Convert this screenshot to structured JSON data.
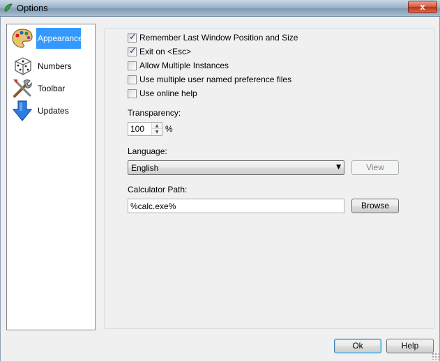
{
  "window": {
    "title": "Options",
    "close_label": "x"
  },
  "sidebar": {
    "items": [
      {
        "label": "Appearance",
        "icon": "palette-icon",
        "selected": true
      },
      {
        "label": "Numbers",
        "icon": "dice-icon",
        "selected": false
      },
      {
        "label": "Toolbar",
        "icon": "tools-icon",
        "selected": false
      },
      {
        "label": "Updates",
        "icon": "download-arrow-icon",
        "selected": false
      }
    ]
  },
  "appearance": {
    "options": [
      {
        "label": "Remember Last Window Position and Size",
        "checked": true
      },
      {
        "label": "Exit on <Esc>",
        "checked": true
      },
      {
        "label": "Allow Multiple Instances",
        "checked": false
      },
      {
        "label": "Use multiple user named preference files",
        "checked": false
      },
      {
        "label": "Use online help",
        "checked": false
      }
    ],
    "transparency": {
      "label": "Transparency:",
      "value": "100",
      "unit": "%"
    },
    "language": {
      "label": "Language:",
      "value": "English",
      "view_label": "View"
    },
    "calculator": {
      "label": "Calculator Path:",
      "value": "%calc.exe%",
      "browse_label": "Browse"
    }
  },
  "footer": {
    "ok_label": "Ok",
    "help_label": "Help"
  }
}
